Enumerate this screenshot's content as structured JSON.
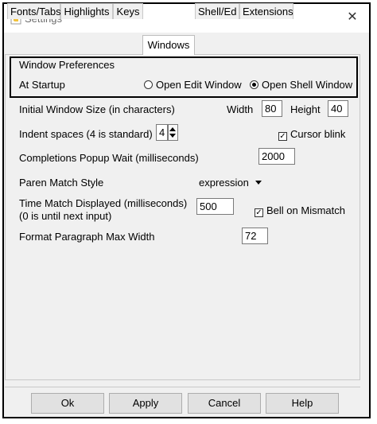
{
  "window": {
    "title": "Settings",
    "close_glyph": "✕",
    "app_icon": "python-icon"
  },
  "tabs": [
    {
      "label": "Fonts/Tabs"
    },
    {
      "label": "Highlights"
    },
    {
      "label": "Keys"
    },
    {
      "label": "Windows",
      "active": true
    },
    {
      "label": "Shell/Ed"
    },
    {
      "label": "Extensions"
    }
  ],
  "window_prefs": {
    "heading": "Window Preferences",
    "startup_label": "At Startup",
    "option_edit": "Open Edit Window",
    "option_shell": "Open Shell Window",
    "selected": "Open Shell Window"
  },
  "initial_size": {
    "label": "Initial Window Size  (in characters)",
    "width_label": "Width",
    "width_value": "80",
    "height_label": "Height",
    "height_value": "40"
  },
  "indent": {
    "label": "Indent spaces (4 is standard)",
    "value": "4"
  },
  "cursor_blink": {
    "label": "Cursor blink",
    "checked": true
  },
  "completions": {
    "label": "Completions Popup Wait (milliseconds)",
    "value": "2000"
  },
  "paren_style": {
    "label": "Paren Match Style",
    "value": "expression"
  },
  "time_match": {
    "label_line1": "Time Match Displayed (milliseconds)",
    "label_line2": "(0 is until next input)",
    "value": "500"
  },
  "bell": {
    "label": "Bell on Mismatch",
    "checked": true
  },
  "format_width": {
    "label": "Format Paragraph Max Width",
    "value": "72"
  },
  "buttons": {
    "ok": "Ok",
    "apply": "Apply",
    "cancel": "Cancel",
    "help": "Help"
  },
  "check_glyph": "✓"
}
